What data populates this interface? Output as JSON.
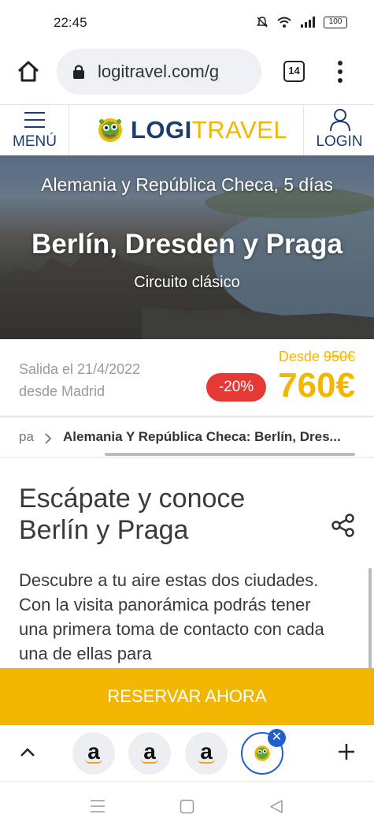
{
  "status_bar": {
    "time": "22:45",
    "battery": "100"
  },
  "browser": {
    "url": "logitravel.com/g",
    "tab_count": "14"
  },
  "site_header": {
    "menu_label": "MENÚ",
    "logo_logi": "LOGI",
    "logo_travel": "TRAVEL",
    "login_label": "LOGIN"
  },
  "hero": {
    "subtitle": "Alemania y República Checa, 5 días",
    "title": "Berlín, Dresden y Praga",
    "tagline": "Circuito clásico"
  },
  "price": {
    "departure_date": "Salida el 21/4/2022",
    "departure_city": "desde Madrid",
    "from_label": "Desde",
    "old_price": "950€",
    "discount": "-20%",
    "price": "760€"
  },
  "breadcrumb": {
    "prev": "pa",
    "current": "Alemania Y República Checa: Berlín, Dres..."
  },
  "article": {
    "heading": "Escápate y conoce Berlín y Praga",
    "body": "Descubre a tu aire estas dos ciudades. Con la visita panorámica podrás tener una primera toma de contacto con cada una de ellas para"
  },
  "cta": {
    "label": "RESERVAR AHORA"
  },
  "tab_bar": {
    "tabs": [
      "a",
      "a",
      "a"
    ],
    "close_glyph": "✕"
  },
  "colors": {
    "brand_blue": "#1c3d6e",
    "brand_yellow": "#f2b600",
    "discount_red": "#e53935",
    "active_blue": "#1e5fd0"
  }
}
